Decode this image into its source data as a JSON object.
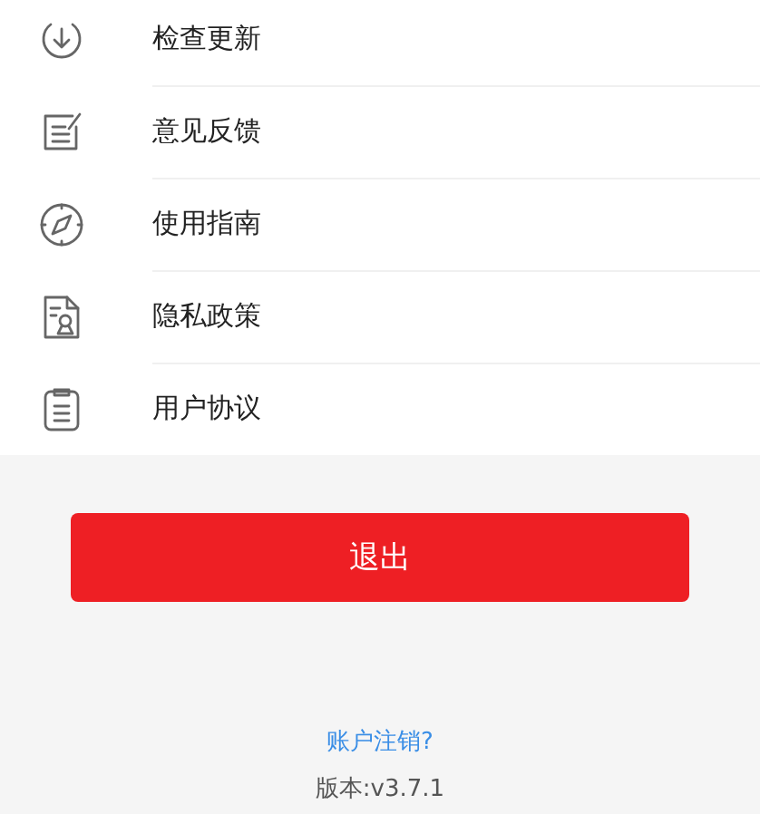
{
  "menu": [
    {
      "label": "检查更新"
    },
    {
      "label": "意见反馈"
    },
    {
      "label": "使用指南"
    },
    {
      "label": "隐私政策"
    },
    {
      "label": "用户协议"
    }
  ],
  "logout_button": "退出",
  "delete_account_link": "账户注销?",
  "version": "版本:v3.7.1"
}
